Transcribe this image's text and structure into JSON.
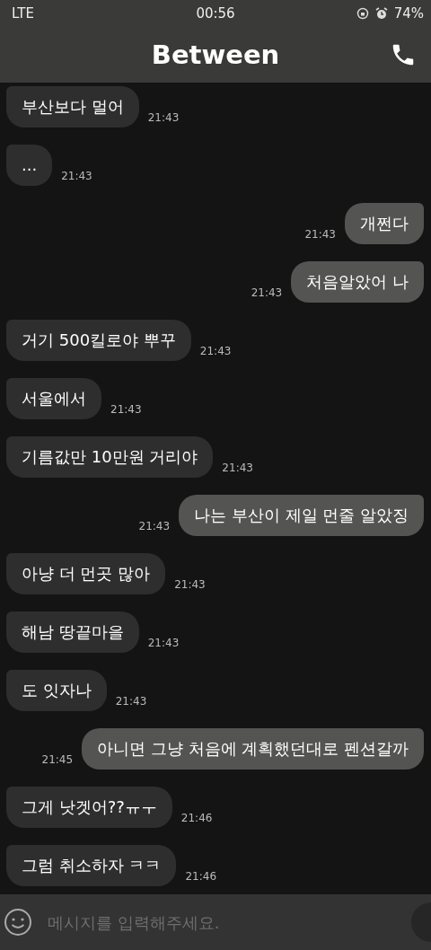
{
  "status_bar": {
    "network": "LTE",
    "time": "00:56",
    "battery": "74%"
  },
  "header": {
    "title": "Between"
  },
  "messages": [
    {
      "kind": "in",
      "text": "부산보다 멀어",
      "time": "21:43"
    },
    {
      "kind": "in",
      "text": "...",
      "time": "21:43"
    },
    {
      "kind": "out",
      "text": "개쩐다",
      "time": "21:43"
    },
    {
      "kind": "out",
      "text": "처음알았어 나",
      "time": "21:43"
    },
    {
      "kind": "in",
      "text": "거기 500킬로야 뿌꾸",
      "time": "21:43"
    },
    {
      "kind": "in",
      "text": "서울에서",
      "time": "21:43"
    },
    {
      "kind": "in",
      "text": "기름값만 10만원 거리야",
      "time": "21:43"
    },
    {
      "kind": "out",
      "text": "나는 부산이 제일 먼줄 알았징",
      "time": "21:43"
    },
    {
      "kind": "in",
      "text": "아냥 더 먼곳 많아",
      "time": "21:43"
    },
    {
      "kind": "in",
      "text": "해남 땅끝마을",
      "time": "21:43"
    },
    {
      "kind": "in",
      "text": "도 잇자나",
      "time": "21:43"
    },
    {
      "kind": "out",
      "text": "아니면 그냥 처음에 계획했던대로 펜션갈까",
      "time": "21:45"
    },
    {
      "kind": "in",
      "text": "그게 낫겟어??ㅠㅜ",
      "time": "21:46"
    },
    {
      "kind": "in",
      "text": "그럼 취소하자 ㅋㅋ",
      "time": "21:46"
    }
  ],
  "composer": {
    "placeholder": "메시지를 입력해주세요."
  }
}
